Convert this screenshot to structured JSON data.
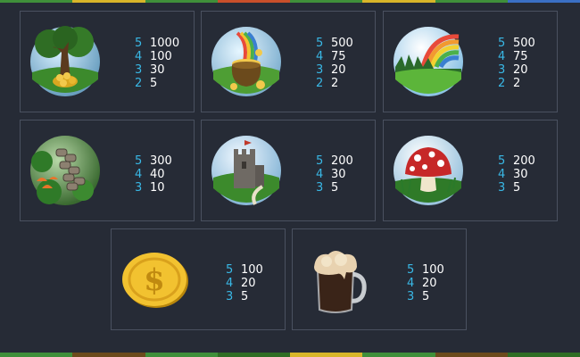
{
  "colors": {
    "accent": "#39b8e6",
    "text": "#ffffff",
    "panel_border": "#4a5160",
    "background": "#262b36"
  },
  "symbols": [
    {
      "icon": "gold-tree-icon",
      "pays": [
        {
          "count": "5",
          "amount": "1000"
        },
        {
          "count": "4",
          "amount": "100"
        },
        {
          "count": "3",
          "amount": "30"
        },
        {
          "count": "2",
          "amount": "5"
        }
      ]
    },
    {
      "icon": "pot-of-gold-icon",
      "pays": [
        {
          "count": "5",
          "amount": "500"
        },
        {
          "count": "4",
          "amount": "75"
        },
        {
          "count": "3",
          "amount": "20"
        },
        {
          "count": "2",
          "amount": "2"
        }
      ]
    },
    {
      "icon": "rainbow-icon",
      "pays": [
        {
          "count": "5",
          "amount": "500"
        },
        {
          "count": "4",
          "amount": "75"
        },
        {
          "count": "3",
          "amount": "20"
        },
        {
          "count": "2",
          "amount": "2"
        }
      ]
    },
    {
      "icon": "stone-wall-icon",
      "pays": [
        {
          "count": "5",
          "amount": "300"
        },
        {
          "count": "4",
          "amount": "40"
        },
        {
          "count": "3",
          "amount": "10"
        }
      ]
    },
    {
      "icon": "castle-tower-icon",
      "pays": [
        {
          "count": "5",
          "amount": "200"
        },
        {
          "count": "4",
          "amount": "30"
        },
        {
          "count": "3",
          "amount": "5"
        }
      ]
    },
    {
      "icon": "mushroom-icon",
      "pays": [
        {
          "count": "5",
          "amount": "200"
        },
        {
          "count": "4",
          "amount": "30"
        },
        {
          "count": "3",
          "amount": "5"
        }
      ]
    },
    {
      "icon": "gold-coin-icon",
      "pays": [
        {
          "count": "5",
          "amount": "100"
        },
        {
          "count": "4",
          "amount": "20"
        },
        {
          "count": "3",
          "amount": "5"
        }
      ]
    },
    {
      "icon": "beer-mug-icon",
      "pays": [
        {
          "count": "5",
          "amount": "100"
        },
        {
          "count": "4",
          "amount": "20"
        },
        {
          "count": "3",
          "amount": "5"
        }
      ]
    }
  ]
}
